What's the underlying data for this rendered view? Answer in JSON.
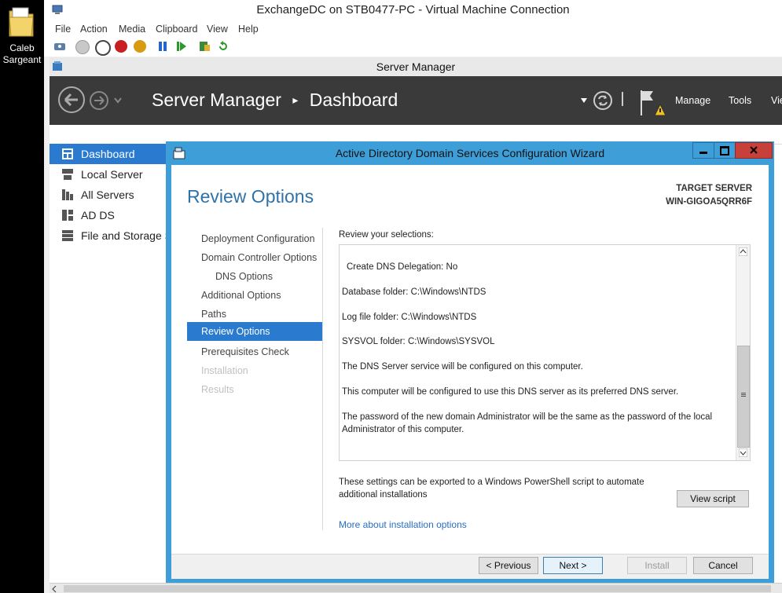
{
  "desktop_icon": {
    "label": "Caleb Sargeant"
  },
  "vm": {
    "title": "ExchangeDC on STB0477-PC - Virtual Machine Connection",
    "menu": [
      "File",
      "Action",
      "Media",
      "Clipboard",
      "View",
      "Help"
    ]
  },
  "server_manager": {
    "window_title": "Server Manager",
    "breadcrumb_root": "Server Manager",
    "breadcrumb_sep": "▸",
    "breadcrumb_page": "Dashboard",
    "menu": {
      "manage": "Manage",
      "tools": "Tools",
      "view": "Vie"
    },
    "sidebar": [
      {
        "label": "Dashboard",
        "icon": "dashboard-icon"
      },
      {
        "label": "Local Server",
        "icon": "server-icon"
      },
      {
        "label": "All Servers",
        "icon": "servers-icon"
      },
      {
        "label": "AD DS",
        "icon": "ad-ds-icon"
      },
      {
        "label": "File and Storage S",
        "icon": "storage-icon"
      }
    ]
  },
  "wizard": {
    "title": "Active Directory Domain Services Configuration Wizard",
    "heading": "Review Options",
    "target_label": "TARGET SERVER",
    "target_name": "WIN-GIGOA5QRR6F",
    "steps": [
      "Deployment Configuration",
      "Domain Controller Options",
      "DNS Options",
      "Additional Options",
      "Paths",
      "Review Options",
      "Prerequisites Check",
      "Installation",
      "Results"
    ],
    "review_label": "Review your selections:",
    "review_lines": [
      "Create DNS Delegation: No",
      "Database folder: C:\\Windows\\NTDS",
      "Log file folder: C:\\Windows\\NTDS",
      "SYSVOL folder: C:\\Windows\\SYSVOL",
      "The DNS Server service will be configured on this computer.",
      "This computer will be configured to use this DNS server as its preferred DNS server.",
      "The password of the new domain Administrator will be the same as the password of the local Administrator of this computer."
    ],
    "export_text": "These settings can be exported to a Windows PowerShell script to automate additional installations",
    "view_script": "View script",
    "more_link": "More about installation options",
    "buttons": {
      "previous": "< Previous",
      "next": "Next >",
      "install": "Install",
      "cancel": "Cancel"
    }
  },
  "colors": {
    "accent": "#2a7bd0",
    "wizard_border": "#3e9ed8",
    "header_bg": "#3a3a3a"
  }
}
